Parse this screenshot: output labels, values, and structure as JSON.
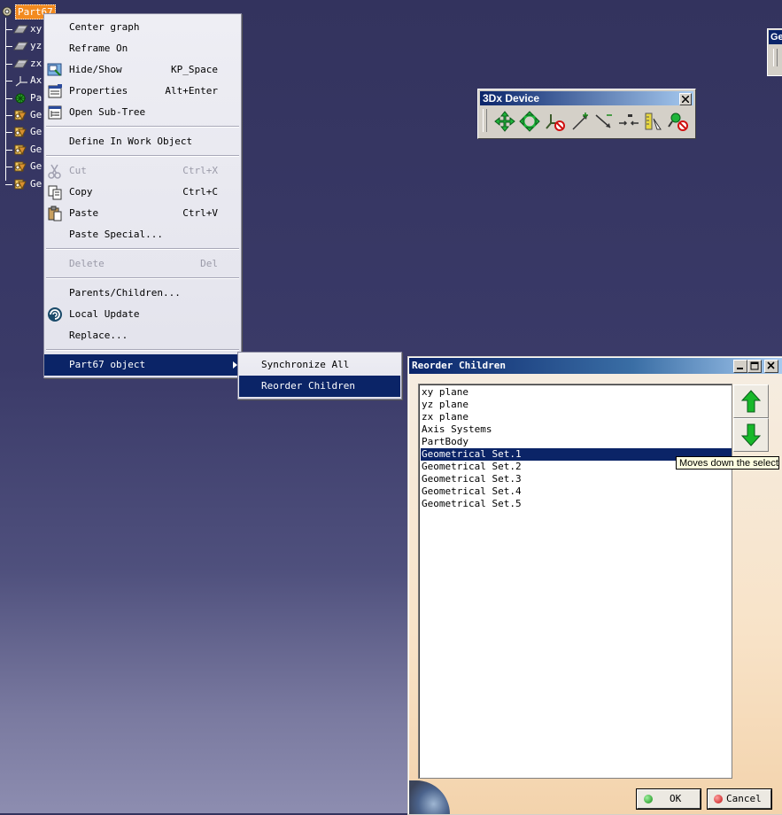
{
  "tree": {
    "root_label": "Part67",
    "items": [
      {
        "label": "xy",
        "icon": "plane-icon"
      },
      {
        "label": "yz",
        "icon": "plane-icon"
      },
      {
        "label": "zx",
        "icon": "plane-icon"
      },
      {
        "label": "Ax",
        "icon": "axis-system-icon"
      },
      {
        "label": "Pa",
        "icon": "part-body-icon"
      },
      {
        "label": "Ge",
        "icon": "geometrical-set-icon"
      },
      {
        "label": "Ge",
        "icon": "geometrical-set-icon"
      },
      {
        "label": "Ge",
        "icon": "geometrical-set-icon"
      },
      {
        "label": "Ge",
        "icon": "geometrical-set-icon"
      },
      {
        "label": "Ge",
        "icon": "geometrical-set-icon"
      }
    ]
  },
  "context_menu": {
    "items": [
      {
        "label": "Center graph",
        "shortcut": "",
        "icon": ""
      },
      {
        "label": "Reframe On",
        "shortcut": "",
        "icon": ""
      },
      {
        "label": "Hide/Show",
        "shortcut": "KP_Space",
        "icon": "hide-show-icon"
      },
      {
        "label": "Properties",
        "shortcut": "Alt+Enter",
        "icon": "properties-icon"
      },
      {
        "label": "Open Sub-Tree",
        "shortcut": "",
        "icon": "open-subtree-icon"
      },
      {
        "label": "Define In Work Object",
        "shortcut": "",
        "icon": ""
      },
      {
        "label": "Cut",
        "shortcut": "Ctrl+X",
        "icon": "scissors-icon",
        "disabled": true
      },
      {
        "label": "Copy",
        "shortcut": "Ctrl+C",
        "icon": "copy-icon"
      },
      {
        "label": "Paste",
        "shortcut": "Ctrl+V",
        "icon": "paste-icon"
      },
      {
        "label": "Paste Special...",
        "shortcut": "",
        "icon": ""
      },
      {
        "label": "Delete",
        "shortcut": "Del",
        "icon": "",
        "disabled": true
      },
      {
        "label": "Parents/Children...",
        "shortcut": "",
        "icon": ""
      },
      {
        "label": "Local Update",
        "shortcut": "",
        "icon": "local-update-icon"
      },
      {
        "label": "Replace...",
        "shortcut": "",
        "icon": ""
      },
      {
        "label": "Part67 object",
        "shortcut": "",
        "icon": "",
        "submenu": true
      }
    ]
  },
  "submenu": {
    "items": [
      {
        "label": "Synchronize All"
      },
      {
        "label": "Reorder Children"
      }
    ]
  },
  "toolbar_3dx": {
    "title": "3Dx Device",
    "buttons": [
      "pan-icon",
      "rotate-icon",
      "rotation-lock-icon",
      "zoom-in-icon",
      "zoom-out-icon",
      "fit-all-icon",
      "sensitivity-icon",
      "dominant-lock-icon"
    ]
  },
  "edge_panel": {
    "title": "Ge"
  },
  "dialog": {
    "title": "Reorder Children",
    "items": [
      "xy plane",
      "yz plane",
      "zx plane",
      "Axis Systems",
      "PartBody",
      "Geometrical Set.1",
      "Geometrical Set.2",
      "Geometrical Set.3",
      "Geometrical Set.4",
      "Geometrical Set.5"
    ],
    "selected_index": 5,
    "ok_label": "OK",
    "cancel_label": "Cancel",
    "tooltip": "Moves down the selected"
  },
  "colors": {
    "selection": "#0b2467",
    "tree_root_highlight": "#f28a1f",
    "arrow_green": "#18b82a"
  }
}
